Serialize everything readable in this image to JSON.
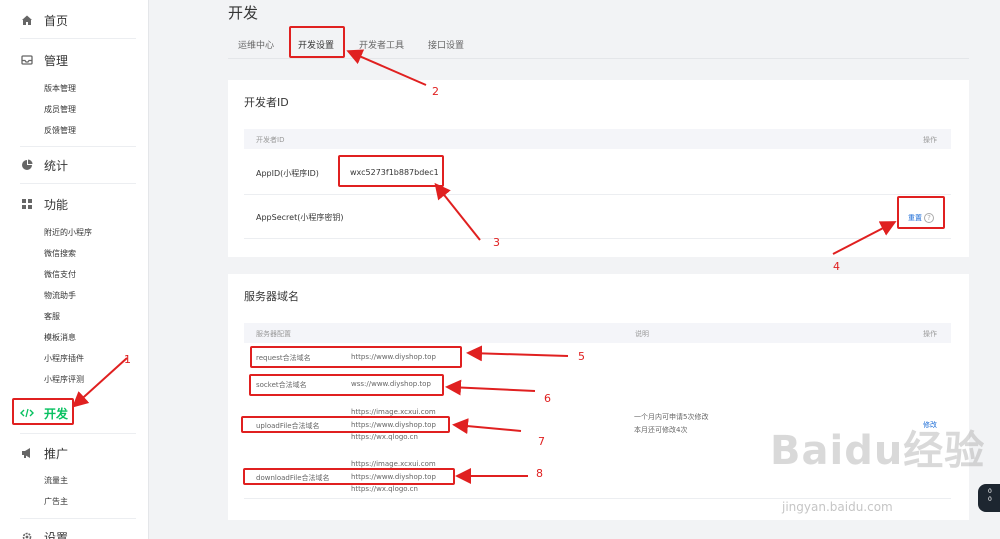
{
  "sidebar": {
    "home": {
      "label": "首页",
      "icon": "home-icon"
    },
    "manage": {
      "label": "管理",
      "icon": "inbox-icon",
      "items": [
        "版本管理",
        "成员管理",
        "反馈管理"
      ]
    },
    "stats": {
      "label": "统计",
      "icon": "pie-chart-icon"
    },
    "features": {
      "label": "功能",
      "icon": "grid-icon",
      "items": [
        "附近的小程序",
        "微信搜索",
        "微信支付",
        "物流助手",
        "客服",
        "模板消息",
        "小程序插件",
        "小程序评测"
      ]
    },
    "develop": {
      "label": "开发",
      "icon": "code-icon"
    },
    "promote": {
      "label": "推广",
      "icon": "megaphone-icon",
      "items": [
        "流量主",
        "广告主"
      ]
    },
    "settings": {
      "label": "设置",
      "icon": "gear-icon"
    }
  },
  "page": {
    "title": "开发"
  },
  "tabs": [
    {
      "label": "运维中心"
    },
    {
      "label": "开发设置",
      "active": true
    },
    {
      "label": "开发者工具"
    },
    {
      "label": "接口设置"
    }
  ],
  "developer_id": {
    "title": "开发者ID",
    "col_name": "开发者ID",
    "col_action": "操作",
    "rows": [
      {
        "label": "AppID(小程序ID)",
        "value": "wxc5273f1b887bdec1"
      },
      {
        "label": "AppSecret(小程序密钥)",
        "action": "重置"
      }
    ]
  },
  "server_domain": {
    "title": "服务器域名",
    "col_config": "服务器配置",
    "col_desc": "说明",
    "col_action": "操作",
    "rows": [
      {
        "label": "request合法域名",
        "values": [
          "https://www.diyshop.top"
        ]
      },
      {
        "label": "socket合法域名",
        "values": [
          "wss://www.diyshop.top"
        ]
      },
      {
        "label": "uploadFile合法域名",
        "values": [
          "https://image.xcxui.com",
          "https://www.diyshop.top",
          "https://wx.qlogo.cn"
        ]
      },
      {
        "label": "downloadFile合法域名",
        "values": [
          "https://image.xcxui.com",
          "https://www.diyshop.top",
          "https://wx.qlogo.cn"
        ]
      }
    ],
    "note_line1": "一个月内可申请5次修改",
    "note_line2": "本月还可修改4次",
    "modify": "修改"
  },
  "annotations": [
    "1",
    "2",
    "3",
    "4",
    "5",
    "6",
    "7",
    "8"
  ],
  "watermark": {
    "main": "Baidu经验",
    "sub": "jingyan.baidu.com"
  },
  "colors": {
    "accent": "#07c160",
    "annotation": "#e02020",
    "link": "#1a6bd6"
  }
}
